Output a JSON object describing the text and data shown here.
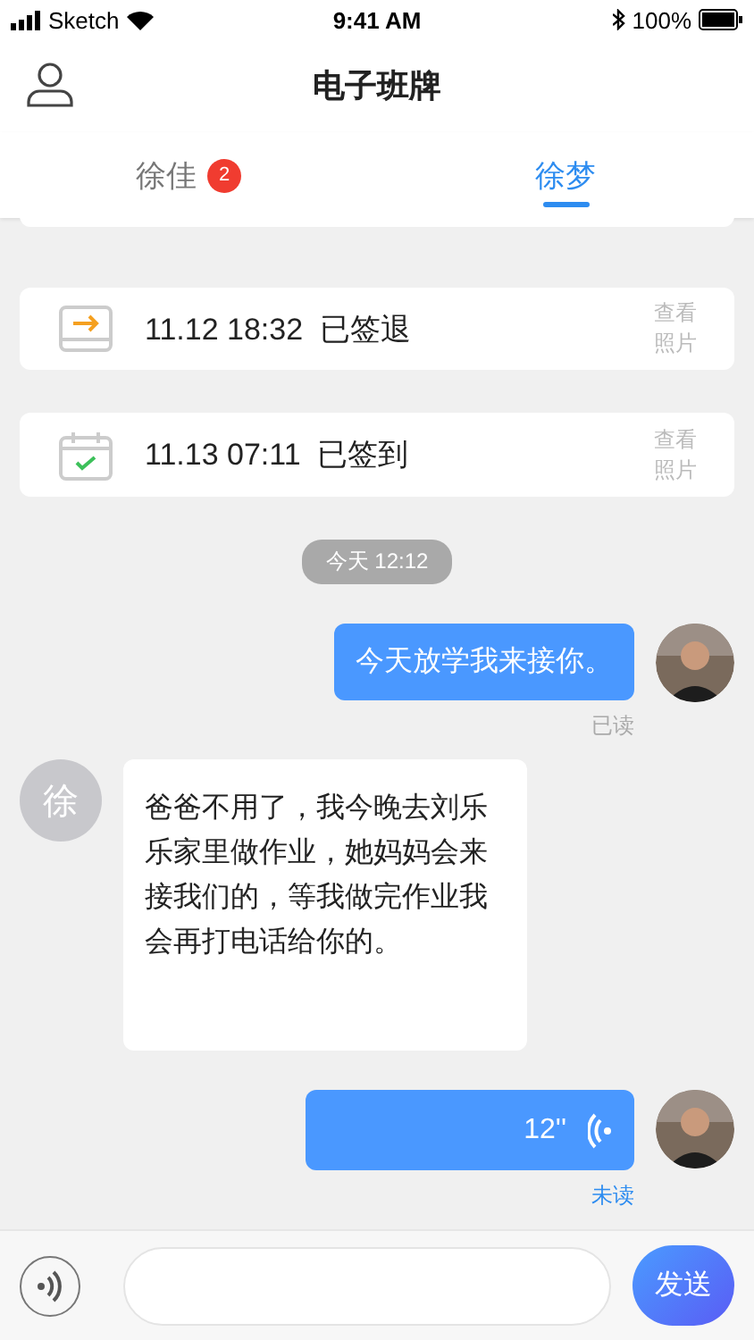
{
  "status_bar": {
    "carrier": "Sketch",
    "time": "9:41 AM",
    "battery": "100%"
  },
  "header": {
    "title": "电子班牌"
  },
  "tabs": [
    {
      "label": "徐佳",
      "badge": "2",
      "selected": false
    },
    {
      "label": "徐梦",
      "selected": true
    }
  ],
  "records": [
    {
      "kind": "checkout",
      "text": "11.12 18:32  已签退",
      "action": "查看照片"
    },
    {
      "kind": "checkin",
      "text": "11.13 07:11  已签到",
      "action": "查看照片"
    }
  ],
  "time_divider": "今天 12:12",
  "messages": [
    {
      "kind": "text",
      "outgoing": true,
      "text": "今天放学我来接你。",
      "status": "已读",
      "read": true
    },
    {
      "kind": "text",
      "outgoing": false,
      "avatar_initial": "徐",
      "text": "爸爸不用了，我今晚去刘乐乐家里做作业，她妈妈会来接我们的，等我做完作业我会再打电话给你的。"
    },
    {
      "kind": "voice",
      "outgoing": true,
      "duration": "12''",
      "status": "未读",
      "read": false
    }
  ],
  "input_bar": {
    "send": "发送"
  }
}
